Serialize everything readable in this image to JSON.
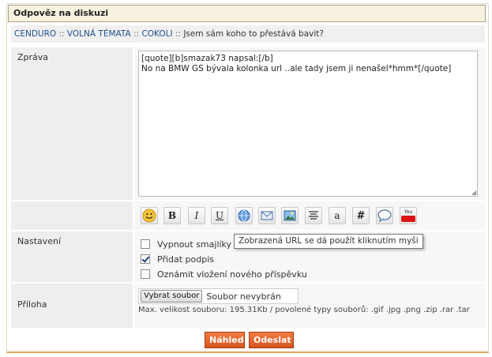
{
  "header": {
    "title": "Odpověz na diskuzi"
  },
  "breadcrumb": {
    "items": [
      "CENDURO",
      "VOLNÁ TÉMATA",
      "COKOLI",
      "Jsem sám koho to přestává bavit?"
    ],
    "separator": "::"
  },
  "message": {
    "label": "Zpráva",
    "text": "[quote][b]smazak73 napsal:[/b]\nNo na BMW GS bývala kolonka url ..ale tady jsem ji nenašel*hmm*[/quote]"
  },
  "toolbar": {
    "buttons": [
      {
        "icon": "smiley-icon"
      },
      {
        "icon": "bold-icon",
        "glyph": "B"
      },
      {
        "icon": "italic-icon",
        "glyph": "I"
      },
      {
        "icon": "underline-icon",
        "glyph": "U"
      },
      {
        "icon": "link-icon"
      },
      {
        "icon": "email-icon"
      },
      {
        "icon": "image-icon"
      },
      {
        "icon": "align-center-icon"
      },
      {
        "icon": "font-icon",
        "glyph": "a"
      },
      {
        "icon": "hash-icon",
        "glyph": "#"
      },
      {
        "icon": "speech-bubble-icon"
      },
      {
        "icon": "youtube-icon",
        "glyph": "You"
      }
    ],
    "tooltip": "Zobrazená URL se dá použít kliknutím myši"
  },
  "settings": {
    "label": "Nastavení",
    "options": [
      {
        "label": "Vypnout smajlíky",
        "checked": false
      },
      {
        "label": "Přidat podpis",
        "checked": true
      },
      {
        "label": "Oznámit vložení nového příspěvku",
        "checked": false
      }
    ]
  },
  "attachment": {
    "label": "Příloha",
    "browse_label": "Vybrat soubor",
    "status": "Soubor nevybrán",
    "note": "Max. velikost souboru: 195.31Kb / povolené typy souborů: .gif .jpg .png .zip .rar .tar"
  },
  "actions": {
    "preview_label": "Náhled",
    "submit_label": "Odeslat"
  },
  "colors": {
    "accent": "#e0622a",
    "header_bg": "#f7f2df",
    "link": "#1e4f8c"
  }
}
